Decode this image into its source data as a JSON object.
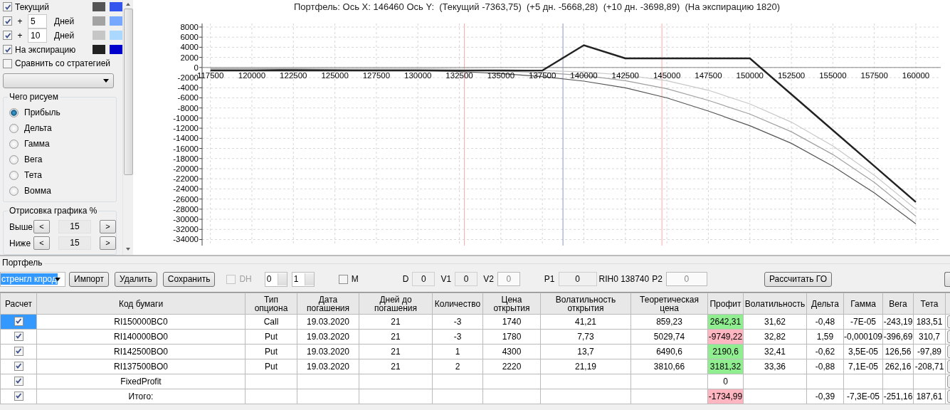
{
  "settings_panel": {
    "curves": [
      {
        "kind": "current",
        "label": "Текущий",
        "checked": true,
        "swatches": [
          {
            "color": "#555555"
          },
          {
            "color": "#3355ee"
          }
        ]
      },
      {
        "kind": "days",
        "prefix": "+",
        "days": "5",
        "unit": "Дней",
        "checked": true,
        "swatches": [
          {
            "color": "#a3a3a3"
          },
          {
            "color": "#77a8ff"
          }
        ]
      },
      {
        "kind": "days",
        "prefix": "+",
        "days": "10",
        "unit": "Дней",
        "checked": true,
        "swatches": [
          {
            "color": "#c6c6c6"
          },
          {
            "color": "#aad8ff"
          }
        ]
      },
      {
        "kind": "expiration",
        "label": "На экспирацию",
        "checked": true,
        "swatches": [
          {
            "color": "#222222"
          },
          {
            "color": "#0000cc"
          }
        ]
      }
    ],
    "compare": {
      "label": "Сравнить со стратегией",
      "checked": false
    },
    "draw_group": {
      "title": "Чего рисуем",
      "options": [
        {
          "label": "Прибыль",
          "selected": true
        },
        {
          "label": "Дельта",
          "selected": false
        },
        {
          "label": "Гамма",
          "selected": false
        },
        {
          "label": "Вега",
          "selected": false
        },
        {
          "label": "Тета",
          "selected": false
        },
        {
          "label": "Вомма",
          "selected": false
        }
      ]
    },
    "range_group": {
      "title": "Отрисовка графика %",
      "rows": [
        {
          "label": "Выше",
          "value": "15",
          "decrement": "<",
          "increment": ">"
        },
        {
          "label": "Ниже",
          "value": "15",
          "decrement": "<",
          "increment": ">"
        }
      ]
    }
  },
  "chart": {
    "title": "Портфель: Ось X: 146460 Ось Y:  (Текущий -7363,75)  (+5 дн. -5668,28)  (+10 дн. -3698,89)  (На экспирацию 1820)",
    "chart_data": {
      "type": "line",
      "x": [
        117500,
        120000,
        122500,
        125000,
        127500,
        130000,
        132500,
        135000,
        137500,
        140000,
        142500,
        145000,
        147500,
        150000,
        152500,
        155000,
        157500,
        160000
      ],
      "series": [
        {
          "color": "#555555",
          "values": [
            -300,
            -300,
            -400,
            -400,
            -500,
            -600,
            -800,
            -1200,
            -1800,
            -2700,
            -4000,
            -6000,
            -8600,
            -11500,
            -15000,
            -19500,
            -24800,
            -30900
          ]
        },
        {
          "color": "#a0a0a0",
          "values": [
            -200,
            -200,
            -200,
            -300,
            -400,
            -400,
            -500,
            -700,
            -1000,
            -1600,
            -2600,
            -4200,
            -6500,
            -9200,
            -12700,
            -17200,
            -22700,
            -29400
          ]
        },
        {
          "color": "#c8c8c8",
          "values": [
            -100,
            -100,
            -100,
            -200,
            -200,
            -200,
            -300,
            -400,
            -600,
            -900,
            -1500,
            -2600,
            -4500,
            -7200,
            -10800,
            -15500,
            -21300,
            -28000
          ]
        },
        {
          "color": "#222222",
          "values": [
            -600,
            -600,
            -600,
            -600,
            -600,
            -600,
            -600,
            -600,
            -600,
            4400,
            1800,
            1800,
            1800,
            1800,
            -5300,
            -12400,
            -19500,
            -26600
          ]
        }
      ],
      "xlim": [
        117000,
        161500
      ],
      "ylim": [
        -35200,
        8700
      ],
      "xticks": [
        117500,
        120000,
        122500,
        125000,
        127500,
        130000,
        132500,
        135000,
        137500,
        140000,
        142500,
        145000,
        147500,
        150000,
        152500,
        155000,
        157500,
        160000
      ],
      "yticks": [
        8000,
        6000,
        4000,
        2000,
        0,
        -2000,
        -4000,
        -6000,
        -8000,
        -10000,
        -12000,
        -14000,
        -16000,
        -18000,
        -20000,
        -22000,
        -24000,
        -26000,
        -28000,
        -30000,
        -32000,
        -34000
      ],
      "grid": true,
      "ref_lines": [
        {
          "axis": "x",
          "value": 132800,
          "color": "#ffaaaa"
        },
        {
          "axis": "x",
          "value": 138740,
          "color": "#8899bb"
        },
        {
          "axis": "x",
          "value": 144700,
          "color": "#ffaaaa"
        }
      ]
    }
  },
  "portfolio": {
    "title": "Портфель",
    "toolbar": [
      {
        "kind": "combo",
        "value": "стренгл кпрод",
        "selected": true
      },
      {
        "kind": "button",
        "label": "Импорт"
      },
      {
        "kind": "button",
        "label": "Удалить"
      },
      {
        "kind": "button",
        "label": "Сохранить"
      },
      {
        "kind": "checkbox",
        "label": "DH",
        "checked": false,
        "disabled": true
      },
      {
        "kind": "spinner",
        "value": "0"
      },
      {
        "kind": "spinner",
        "value": "1"
      },
      {
        "kind": "checkbox",
        "label": "M",
        "checked": false,
        "disabled": false
      },
      {
        "kind": "field",
        "label": "D",
        "value": "0",
        "disabled": false
      },
      {
        "kind": "field",
        "label": "V1",
        "value": "0",
        "disabled": false
      },
      {
        "kind": "field",
        "label": "V2",
        "value": "0",
        "disabled": true
      },
      {
        "kind": "field",
        "label": "P1",
        "value": "0",
        "disabled": false
      },
      {
        "kind": "text",
        "text": "RIH0 138740"
      },
      {
        "kind": "field",
        "label": "P2",
        "value": "0",
        "disabled": true
      },
      {
        "kind": "button",
        "label": "Рассчитать ГО"
      },
      {
        "kind": "button"
      }
    ],
    "table": {
      "columns": [
        "Расчет",
        "Код бумаги",
        "Тип\nопциона",
        "Дата\nпогашения",
        "Дней до\nпогашения",
        "Количество",
        "Цена\nоткрытия",
        "Волатильность\nоткрытия",
        "Теоретическая\nцена",
        "Профит",
        "Волатильность",
        "Дельта",
        "Гамма",
        "Вега",
        "Тета"
      ],
      "rows": [
        {
          "checked": true,
          "selected": true,
          "cells": [
            null,
            "RI150000BC0",
            "Call",
            "19.03.2020",
            "21",
            "-3",
            "1740",
            "41,21",
            "859,23",
            {
              "value": "2642,31",
              "color": "#90ee90"
            },
            "31,62",
            "-0,48",
            "-7E-05",
            "-243,19",
            "183,51"
          ]
        },
        {
          "checked": true,
          "selected": false,
          "cells": [
            null,
            "RI140000BO0",
            "Put",
            "19.03.2020",
            "21",
            "-3",
            "1780",
            "7,73",
            "5029,74",
            {
              "value": "-9749,22",
              "color": "#ffb6c1"
            },
            "32,82",
            "1,59",
            "-0,000109",
            "-396,69",
            "310,7"
          ]
        },
        {
          "checked": true,
          "selected": false,
          "cells": [
            null,
            "RI142500BO0",
            "Put",
            "19.03.2020",
            "21",
            "1",
            "4300",
            "13,7",
            "6490,6",
            {
              "value": "2190,6",
              "color": "#90ee90"
            },
            "32,41",
            "-0,62",
            "3,5E-05",
            "126,56",
            "-97,89"
          ]
        },
        {
          "checked": true,
          "selected": false,
          "cells": [
            null,
            "RI137500BO0",
            "Put",
            "19.03.2020",
            "21",
            "2",
            "2220",
            "21,19",
            "3810,66",
            {
              "value": "3181,32",
              "color": "#90ee90"
            },
            "33,36",
            "-0,88",
            "7,1E-05",
            "262,16",
            "-208,71"
          ]
        },
        {
          "checked": true,
          "selected": false,
          "cells": [
            null,
            "FixedProfit",
            null,
            null,
            null,
            null,
            null,
            null,
            null,
            "0",
            null,
            null,
            null,
            null,
            null
          ]
        },
        {
          "checked": true,
          "selected": false,
          "cells": [
            null,
            "Итого:",
            null,
            null,
            null,
            null,
            null,
            null,
            null,
            {
              "value": "-1734,99",
              "color": "#ffb6c1"
            },
            null,
            "-0,39",
            "-7,3E-05",
            "-251,16",
            "187,61"
          ]
        }
      ]
    }
  }
}
